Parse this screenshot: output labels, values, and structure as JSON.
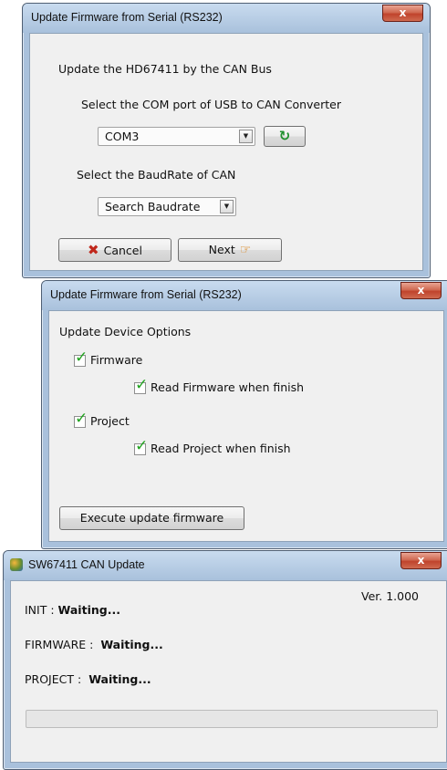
{
  "dialog1": {
    "title": "Update Firmware from Serial (RS232)",
    "close": "x",
    "heading": "Update the HD67411 by the CAN Bus",
    "com_label": "Select the COM port of USB to CAN Converter",
    "com_value": "COM3",
    "baud_label": "Select the BaudRate of CAN",
    "baud_value": "Search Baudrate",
    "cancel_label": "Cancel",
    "next_label": "Next",
    "colors": {
      "cancel_icon": "#c0281c",
      "refresh_icon": "#1f8f2e"
    }
  },
  "dialog2": {
    "title": "Update Firmware from Serial (RS232)",
    "close": "x",
    "heading": "Update Device Options",
    "options": [
      {
        "label": "Firmware",
        "checked": true
      },
      {
        "label": "Read Firmware when finish",
        "checked": true
      },
      {
        "label": "Project",
        "checked": true
      },
      {
        "label": "Read Project when finish",
        "checked": true
      }
    ],
    "execute_label": "Execute update firmware"
  },
  "dialog3": {
    "title": "SW67411 CAN Update",
    "close": "x",
    "version": "Ver. 1.000",
    "init_label": "INIT :",
    "init_status": "Waiting...",
    "firmware_label": "FIRMWARE :",
    "firmware_status": "Waiting...",
    "project_label": "PROJECT :",
    "project_status": "Waiting...",
    "progress": 0
  }
}
